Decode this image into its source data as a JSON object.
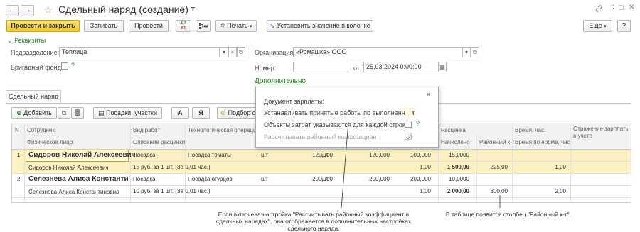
{
  "header": {
    "title": "Сдельный наряд (создание) *",
    "back_icon": "←",
    "forward_icon": "→",
    "star_icon": "☆",
    "link_icon": "🔗",
    "more_icon": "⋮",
    "restore_icon": "□",
    "close_icon": "✕"
  },
  "toolbar": {
    "post_close": "Провести и закрыть",
    "save": "Записать",
    "post": "Провести",
    "dt_kt": "ДТ\nКТ",
    "print": "Печать",
    "set_value": "Установить значение в колонке",
    "more": "Еще",
    "help": "?"
  },
  "requisites": {
    "toggle": "Реквизиты",
    "division_label": "Подразделение:",
    "division_value": "Теплица",
    "org_label": "Организация:",
    "org_value": "«Ромашка» ООО",
    "brigade_label": "Бригадный фонд:",
    "number_label": "Номер:",
    "number_value": "",
    "date_label": "от:",
    "date_value": "25.03.2024  0:00:00",
    "more_link": "Дополнительно"
  },
  "tab": {
    "label": "Сдельный наряд"
  },
  "table_toolbar": {
    "add": "Добавить",
    "plantings": "Посадки, участки",
    "fmt_a": "А",
    "fmt_ya": "Я",
    "pick": "Подбор с"
  },
  "popup": {
    "title": "Документ зарплаты:",
    "row1": "Устанавливать принятые работы по выполненным:",
    "row2": "Объекты затрат указываются для каждой строки:",
    "row3": "Рассчитывать районный коэффициент:",
    "close": "×"
  },
  "table": {
    "headers": {
      "n": "N",
      "employee": "Сотрудник",
      "person": "Физическое лицо",
      "work": "Вид работ",
      "rate_desc": "Описание расценки",
      "tech_op": "Технологическая операция",
      "rate": "Расценка",
      "accrued": "Начислено",
      "regional": "Районный к-т",
      "time": "Время, час.",
      "time_norm": "Время по норме, час.",
      "salary": "Отражение зарплаты в учете"
    },
    "rows": [
      {
        "n": "1",
        "employee": "Сидоров Николай Алексеевич",
        "person": "Сидоров Николай Алексеевич",
        "work": "Посадка",
        "rate_desc": "15 руб. за 1 шт. (За 0,01 час.)",
        "tech_op": "Посадка томаты",
        "unit1": "шт",
        "qty1": "120,000",
        "unit2": "шт",
        "qty2": "120,000",
        "qty3": "100,000",
        "one1": "1,00",
        "rate": "15,0000",
        "accrued": "1 500,00",
        "regional": "225,00",
        "time_norm": "1,00"
      },
      {
        "n": "2",
        "employee": "Селезнева Алиса Константин...",
        "person": "Селезнева Алиса Константиновна",
        "work": "Посадка",
        "rate_desc": "10 руб. за 1 шт. (За 0,01 час.)",
        "tech_op": "Посадка огурцов",
        "unit1": "шт",
        "qty1": "200,000",
        "unit2": "шт",
        "qty2": "200,000",
        "qty3": "200,000",
        "one1": "1,00",
        "rate": "10,0000",
        "accrued": "2 000,00",
        "regional": "300,00",
        "time_norm": "2,00"
      }
    ]
  },
  "annotations": {
    "left": "Если включена настройка \"Рассчитывать районный коэффициент в сдельных нарядах\", она отображается в дополнительных настройках сдельного наряда.",
    "right": "В таблице появится столбец \"Районный к-т\"."
  },
  "colors": {
    "primary": "#f2c52b",
    "selected_row": "#fbf0c2",
    "link": "#1f8b1f",
    "help": "#2d7bc6"
  }
}
